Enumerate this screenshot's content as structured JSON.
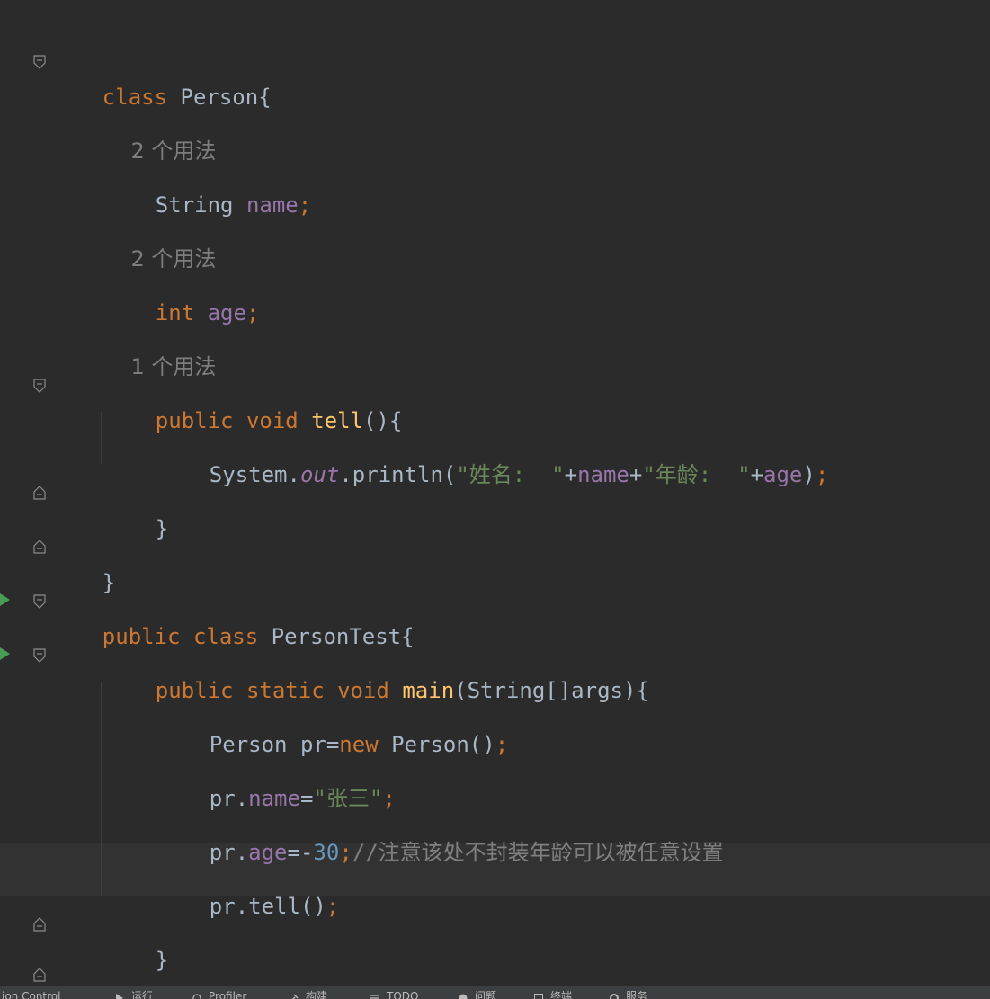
{
  "editor": {
    "lines": {
      "l1": {
        "kw": "class",
        "name": " Person{"
      },
      "l2": {
        "hint": "2 个用法"
      },
      "l3": {
        "type": "String ",
        "field": "name",
        "semi": ";"
      },
      "l4": {
        "hint": "2 个用法"
      },
      "l5": {
        "kw": "int ",
        "field": "age",
        "semi": ";"
      },
      "l6": {
        "hint": "1 个用法"
      },
      "l7": {
        "kw": "public void ",
        "fn": "tell",
        "rest": "(){"
      },
      "l8": {
        "a": "System.",
        "out": "out",
        "b": ".println(",
        "s1": "\"姓名:  \"",
        "plus1": "+",
        "f1": "name",
        "plus2": "+",
        "s2": "\"年龄:  \"",
        "plus3": "+",
        "f2": "age",
        "c": ")",
        "semi": ";"
      },
      "l9": {
        "text": "}"
      },
      "l10": {
        "text": "}"
      },
      "l11": {
        "kw": "public class ",
        "name": "PersonTest{"
      },
      "l12": {
        "kw": "public static void ",
        "fn": "main",
        "rest": "(String[]args){"
      },
      "l13": {
        "a": "Person pr=",
        "kw": "new",
        "b": " Person()",
        "semi": ";"
      },
      "l14": {
        "a": "pr.",
        "field": "name",
        "b": "=",
        "str": "\"张三\"",
        "semi": ";"
      },
      "l15": {
        "a": "pr.",
        "field": "age",
        "b": "=-",
        "num": "30",
        "semi": ";",
        "cmt": "//注意该处不封装年龄可以被任意设置"
      },
      "l16": {
        "a": "pr.tell()",
        "semi": ";"
      },
      "l17": {
        "text": "}"
      },
      "l18": {
        "text": "}"
      }
    }
  },
  "statusbar": {
    "items": [
      "ion Control",
      "运行",
      "Profiler",
      "构建",
      "TODO",
      "问题",
      "终端",
      "服务"
    ]
  },
  "colors": {
    "background": "#2b2b2b",
    "keyword": "#cc7832",
    "function": "#ffc66d",
    "field": "#9876aa",
    "string": "#6a8759",
    "number": "#6897bb",
    "comment": "#808080",
    "run_marker": "#499c54"
  },
  "icons": [
    "fold-icon",
    "run-gutter-icon",
    "play-icon",
    "profiler-icon",
    "hammer-icon",
    "list-icon",
    "warning-icon",
    "terminal-icon",
    "services-icon"
  ]
}
